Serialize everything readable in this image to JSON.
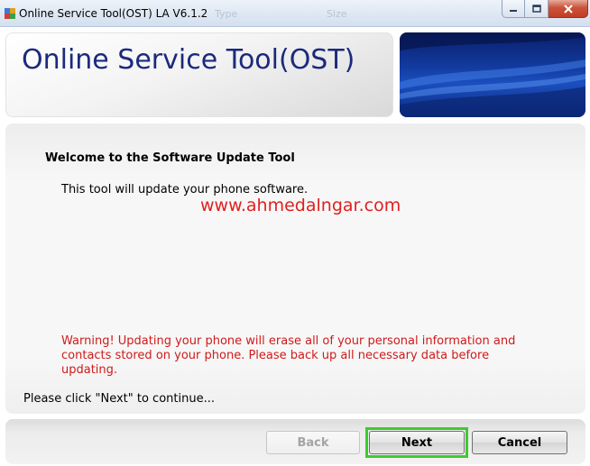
{
  "window": {
    "title": "Online Service Tool(OST) LA V6.1.2",
    "ghost_labels": [
      "Type",
      "Size"
    ],
    "controls": {
      "minimize_icon": "minimize-icon",
      "maximize_icon": "maximize-icon",
      "close_icon": "close-icon"
    }
  },
  "header": {
    "title": "Online Service Tool(OST)"
  },
  "content": {
    "welcome": "Welcome to the Software Update Tool",
    "description": "This tool will update your phone software.",
    "watermark": "www.ahmedalngar.com",
    "warning": "Warning! Updating your phone will erase all of your personal information and contacts stored on your phone. Please back up all necessary data before updating.",
    "continue_hint": "Please click \"Next\" to continue..."
  },
  "footer": {
    "back_label": "Back",
    "next_label": "Next",
    "cancel_label": "Cancel"
  },
  "colors": {
    "title_blue": "#1b2a7c",
    "warning_red": "#d01a1a",
    "highlight_green": "#3bcc2f"
  }
}
